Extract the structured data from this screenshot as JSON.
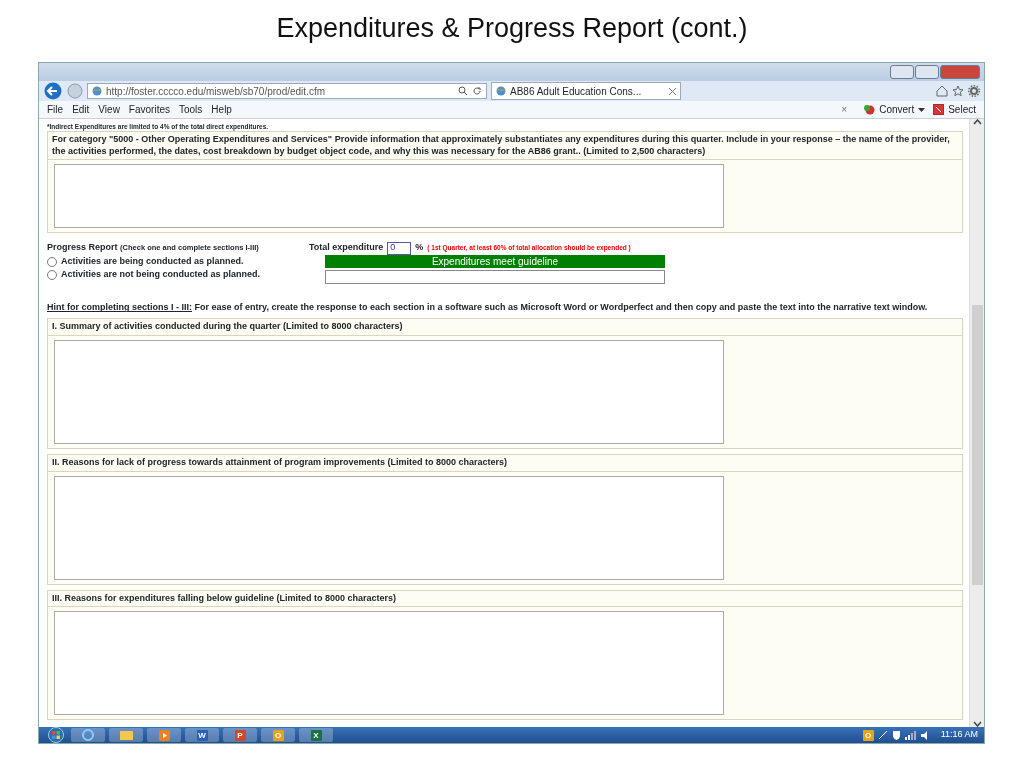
{
  "slide_title": "Expenditures & Progress Report (cont.)",
  "browser": {
    "url": "http://foster.cccco.edu/misweb/sb70/prod/edit.cfm",
    "tab_title": "AB86 Adult Education Cons...",
    "menu": [
      "File",
      "Edit",
      "View",
      "Favorites",
      "Tools",
      "Help"
    ],
    "bar_close": "×",
    "convert": "Convert",
    "select": "Select"
  },
  "form": {
    "note": "*Indirect Expenditures are limited to 4% of the total direct expenditures.",
    "category_prompt": "For category \"5000 - Other Operating Expenditures and Services\" Provide information that approximately substantiates any expenditures during this quarter. Include in your response – the name of the provider, the activities performed, the dates, cost breakdown by budget object code, and why this was necessary for the AB86 grant.. (Limited to 2,500 characters)",
    "progress": {
      "label": "Progress Report",
      "hint": "(Check one and complete sections I-III)",
      "options": [
        {
          "label": "Activities are being conducted as planned.",
          "selected": false
        },
        {
          "label": "Activities are not being conducted as planned.",
          "selected": false
        }
      ],
      "total_label": "Total expenditure",
      "total_value": "0",
      "percent": "%",
      "guideline": "( 1st Quarter, at least 60% of total allocation should be expended )",
      "status": "Expenditures meet guideline"
    },
    "hint_lead": "Hint for completing sections I - III:",
    "hint_text": "For ease of entry, create the response to each section in a software such as Microsoft Word or Wordperfect and then copy and paste the text into the narrative text window.",
    "sections": [
      {
        "title": "I. Summary of activities conducted during the quarter (Limited to 8000 characters)"
      },
      {
        "title": "II. Reasons for lack of progress towards attainment of program improvements (Limited to 8000 characters)"
      },
      {
        "title": "III. Reasons for expenditures falling below guideline (Limited to 8000 characters)"
      }
    ]
  },
  "taskbar": {
    "apps": [
      {
        "letter": "W",
        "color": "#2b5fb4"
      },
      {
        "letter": "P",
        "color": "#d24726"
      },
      {
        "letter": "O",
        "color": "#e8a317"
      },
      {
        "letter": "X",
        "color": "#1e7145"
      }
    ],
    "tray_letter": "O",
    "clock": "11:16 AM"
  }
}
